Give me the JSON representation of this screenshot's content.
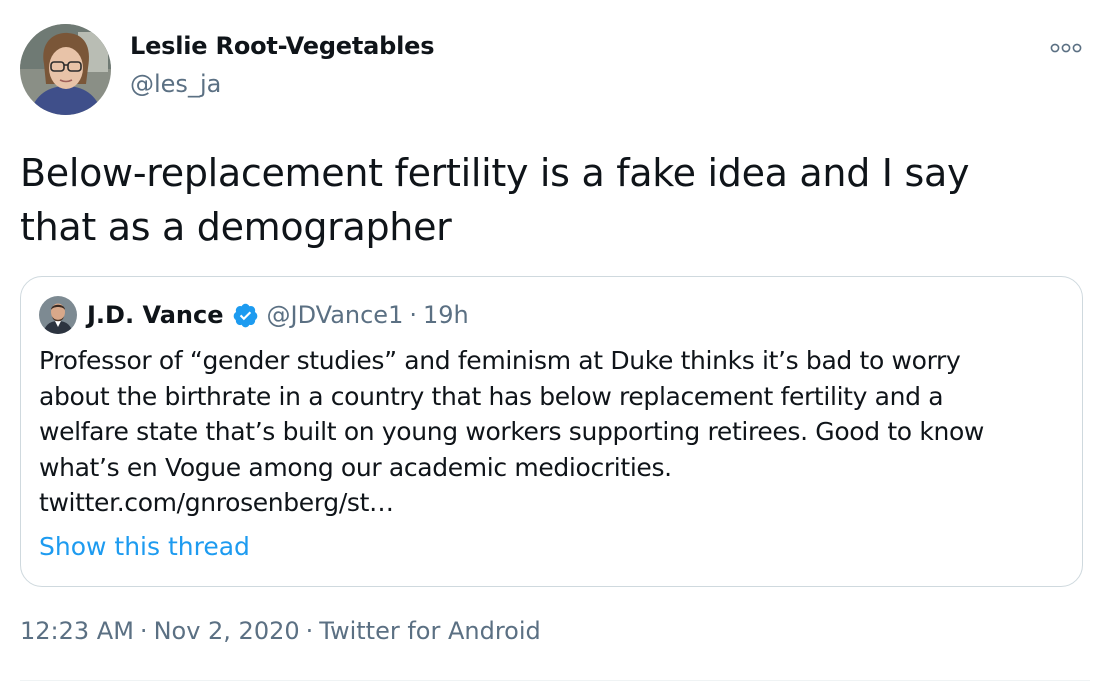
{
  "tweet": {
    "author_name": "Leslie Root-Vegetables",
    "author_handle": "@les_ja",
    "text_lines": [
      "Below-replacement fertility is a fake idea and I say",
      "that as a demographer"
    ],
    "more_icon": "more-horizontal-icon",
    "timestamp": "12:23 AM",
    "date": "Nov 2, 2020",
    "source": "Twitter for Android",
    "separator": "·"
  },
  "quote": {
    "author_name": "J.D. Vance",
    "verified_icon": "verified-badge-icon",
    "author_handle": "@JDVance1",
    "separator": "·",
    "time": "19h",
    "text_lines": [
      "Professor of “gender studies” and feminism at Duke thinks it’s bad to worry",
      "about the birthrate in a country that has below replacement fertility and a",
      "welfare state that’s built on young workers supporting retirees. Good to know",
      "what’s en Vogue among our academic mediocrities.",
      "twitter.com/gnrosenberg/st…"
    ],
    "show_thread": "Show this thread"
  },
  "colors": {
    "text": "#0f1419",
    "secondary": "#5b7083",
    "link": "#1d9bf0",
    "border": "#cfd9de",
    "verified": "#1d9bf0"
  }
}
